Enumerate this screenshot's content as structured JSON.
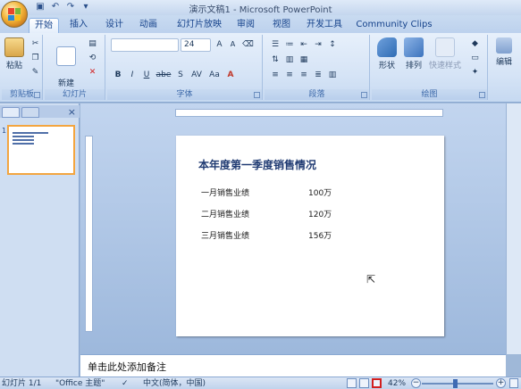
{
  "window": {
    "title": "演示文稿1 - Microsoft PowerPoint"
  },
  "quick_access": {
    "icons": [
      "save-icon",
      "undo-icon",
      "redo-icon",
      "customize-icon"
    ]
  },
  "ribbon": {
    "tabs": [
      "开始",
      "插入",
      "设计",
      "动画",
      "幻灯片放映",
      "审阅",
      "视图",
      "开发工具",
      "Community Clips"
    ],
    "active_tab": "开始",
    "groups": {
      "clipboard": {
        "label": "剪贴板",
        "paste": "粘贴"
      },
      "slides": {
        "label": "幻灯片",
        "new_slide": "新建\n幻灯片"
      },
      "font": {
        "label": "字体",
        "font_name": "",
        "font_size": "24",
        "format_buttons": [
          "B",
          "I",
          "U",
          "abe",
          "S",
          "AV",
          "Aa",
          "A"
        ]
      },
      "paragraph": {
        "label": "段落"
      },
      "drawing": {
        "label": "绘图",
        "shapes": "形状",
        "arrange": "排列",
        "quick_styles": "快速样式"
      },
      "editing": {
        "label": "编辑"
      }
    }
  },
  "slide": {
    "title": "本年度第一季度销售情况",
    "rows": [
      {
        "label": "一月销售业绩",
        "value": "100万"
      },
      {
        "label": "二月销售业绩",
        "value": "120万"
      },
      {
        "label": "三月销售业绩",
        "value": "156万"
      }
    ]
  },
  "thumbnail": {
    "number": "1"
  },
  "notes": {
    "placeholder": "单击此处添加备注"
  },
  "status": {
    "slide_info": "幻灯片 1/1",
    "theme": "\"Office 主题\"",
    "language": "中文(简体，中国)",
    "zoom": "42%",
    "zoom_level": 0.42
  },
  "colors": {
    "title": "#1f3a72",
    "selection_highlight": "#d21f1f",
    "thumb_border": "#f3a540"
  }
}
